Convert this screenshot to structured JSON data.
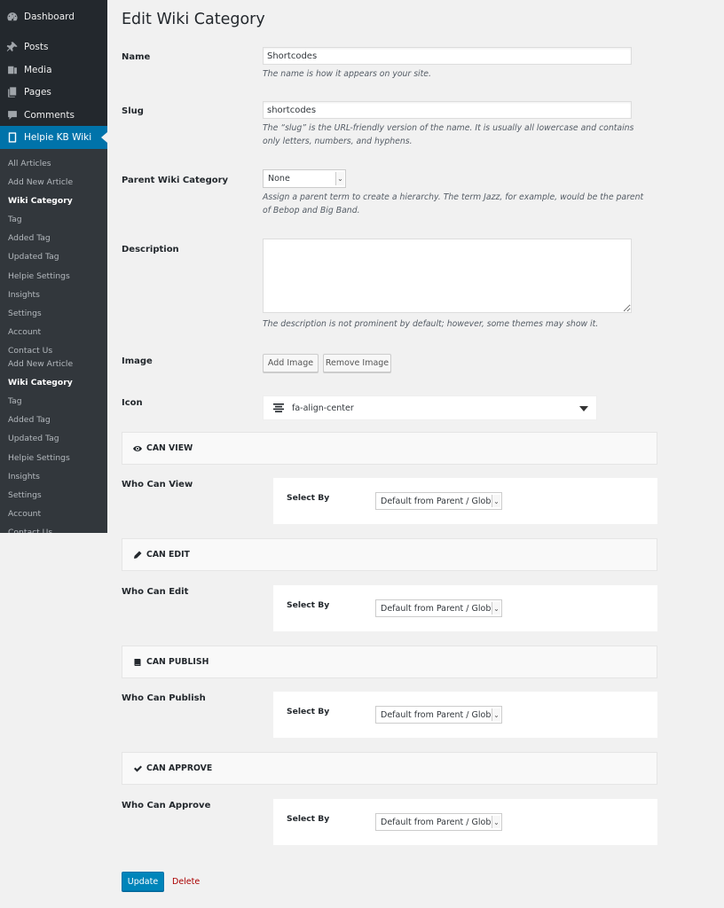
{
  "sidebar": {
    "top_items": [
      {
        "label": "Dashboard",
        "icon": "dashboard-icon"
      },
      {
        "label": "Posts",
        "icon": "pin-icon"
      },
      {
        "label": "Media",
        "icon": "media-icon"
      },
      {
        "label": "Pages",
        "icon": "pages-icon"
      },
      {
        "label": "Comments",
        "icon": "comment-icon"
      },
      {
        "label": "Helpie KB Wiki",
        "icon": "book-icon"
      }
    ],
    "submenu_a": [
      "All Articles",
      "Add New Article",
      "Wiki Category",
      "Tag",
      "Added Tag",
      "Updated Tag",
      "Helpie Settings",
      "Insights",
      "Settings",
      "Account",
      "Contact Us"
    ],
    "submenu_b": [
      "Add New Article",
      "Wiki Category",
      "Tag",
      "Added Tag",
      "Updated Tag",
      "Helpie Settings",
      "Insights",
      "Settings",
      "Account",
      "Contact Us"
    ]
  },
  "page": {
    "title": "Edit Wiki Category",
    "name_label": "Name",
    "name_value": "Shortcodes",
    "name_help": "The name is how it appears on your site.",
    "slug_label": "Slug",
    "slug_value": "shortcodes",
    "slug_help": "The “slug” is the URL-friendly version of the name. It is usually all lowercase and contains only letters, numbers, and hyphens.",
    "parent_label": "Parent Wiki Category",
    "parent_value": "None",
    "parent_help": "Assign a parent term to create a hierarchy. The term Jazz, for example, would be the parent of Bebop and Big Band.",
    "description_label": "Description",
    "description_help": "The description is not prominent by default; however, some themes may show it.",
    "image_label": "Image",
    "add_image": "Add Image",
    "remove_image": "Remove Image",
    "icon_label": "Icon",
    "icon_value": "fa-align-center"
  },
  "permissions": [
    {
      "header": "CAN VIEW",
      "icon": "eye-icon",
      "row_label": "Who Can View",
      "select_by": "Select By",
      "value": "Default from Parent / Global"
    },
    {
      "header": "CAN EDIT",
      "icon": "pencil-icon",
      "row_label": "Who Can Edit",
      "select_by": "Select By",
      "value": "Default from Parent / Global"
    },
    {
      "header": "CAN PUBLISH",
      "icon": "book-icon",
      "row_label": "Who Can Publish",
      "select_by": "Select By",
      "value": "Default from Parent / Global"
    },
    {
      "header": "CAN APPROVE",
      "icon": "check-icon",
      "row_label": "Who Can Approve",
      "select_by": "Select By",
      "value": "Default from Parent / Global"
    }
  ],
  "actions": {
    "update": "Update",
    "delete": "Delete"
  },
  "colors": {
    "sidebar_bg": "#23282d",
    "accent": "#0073aa",
    "button_primary": "#0085ba",
    "delete": "#aa0000"
  }
}
